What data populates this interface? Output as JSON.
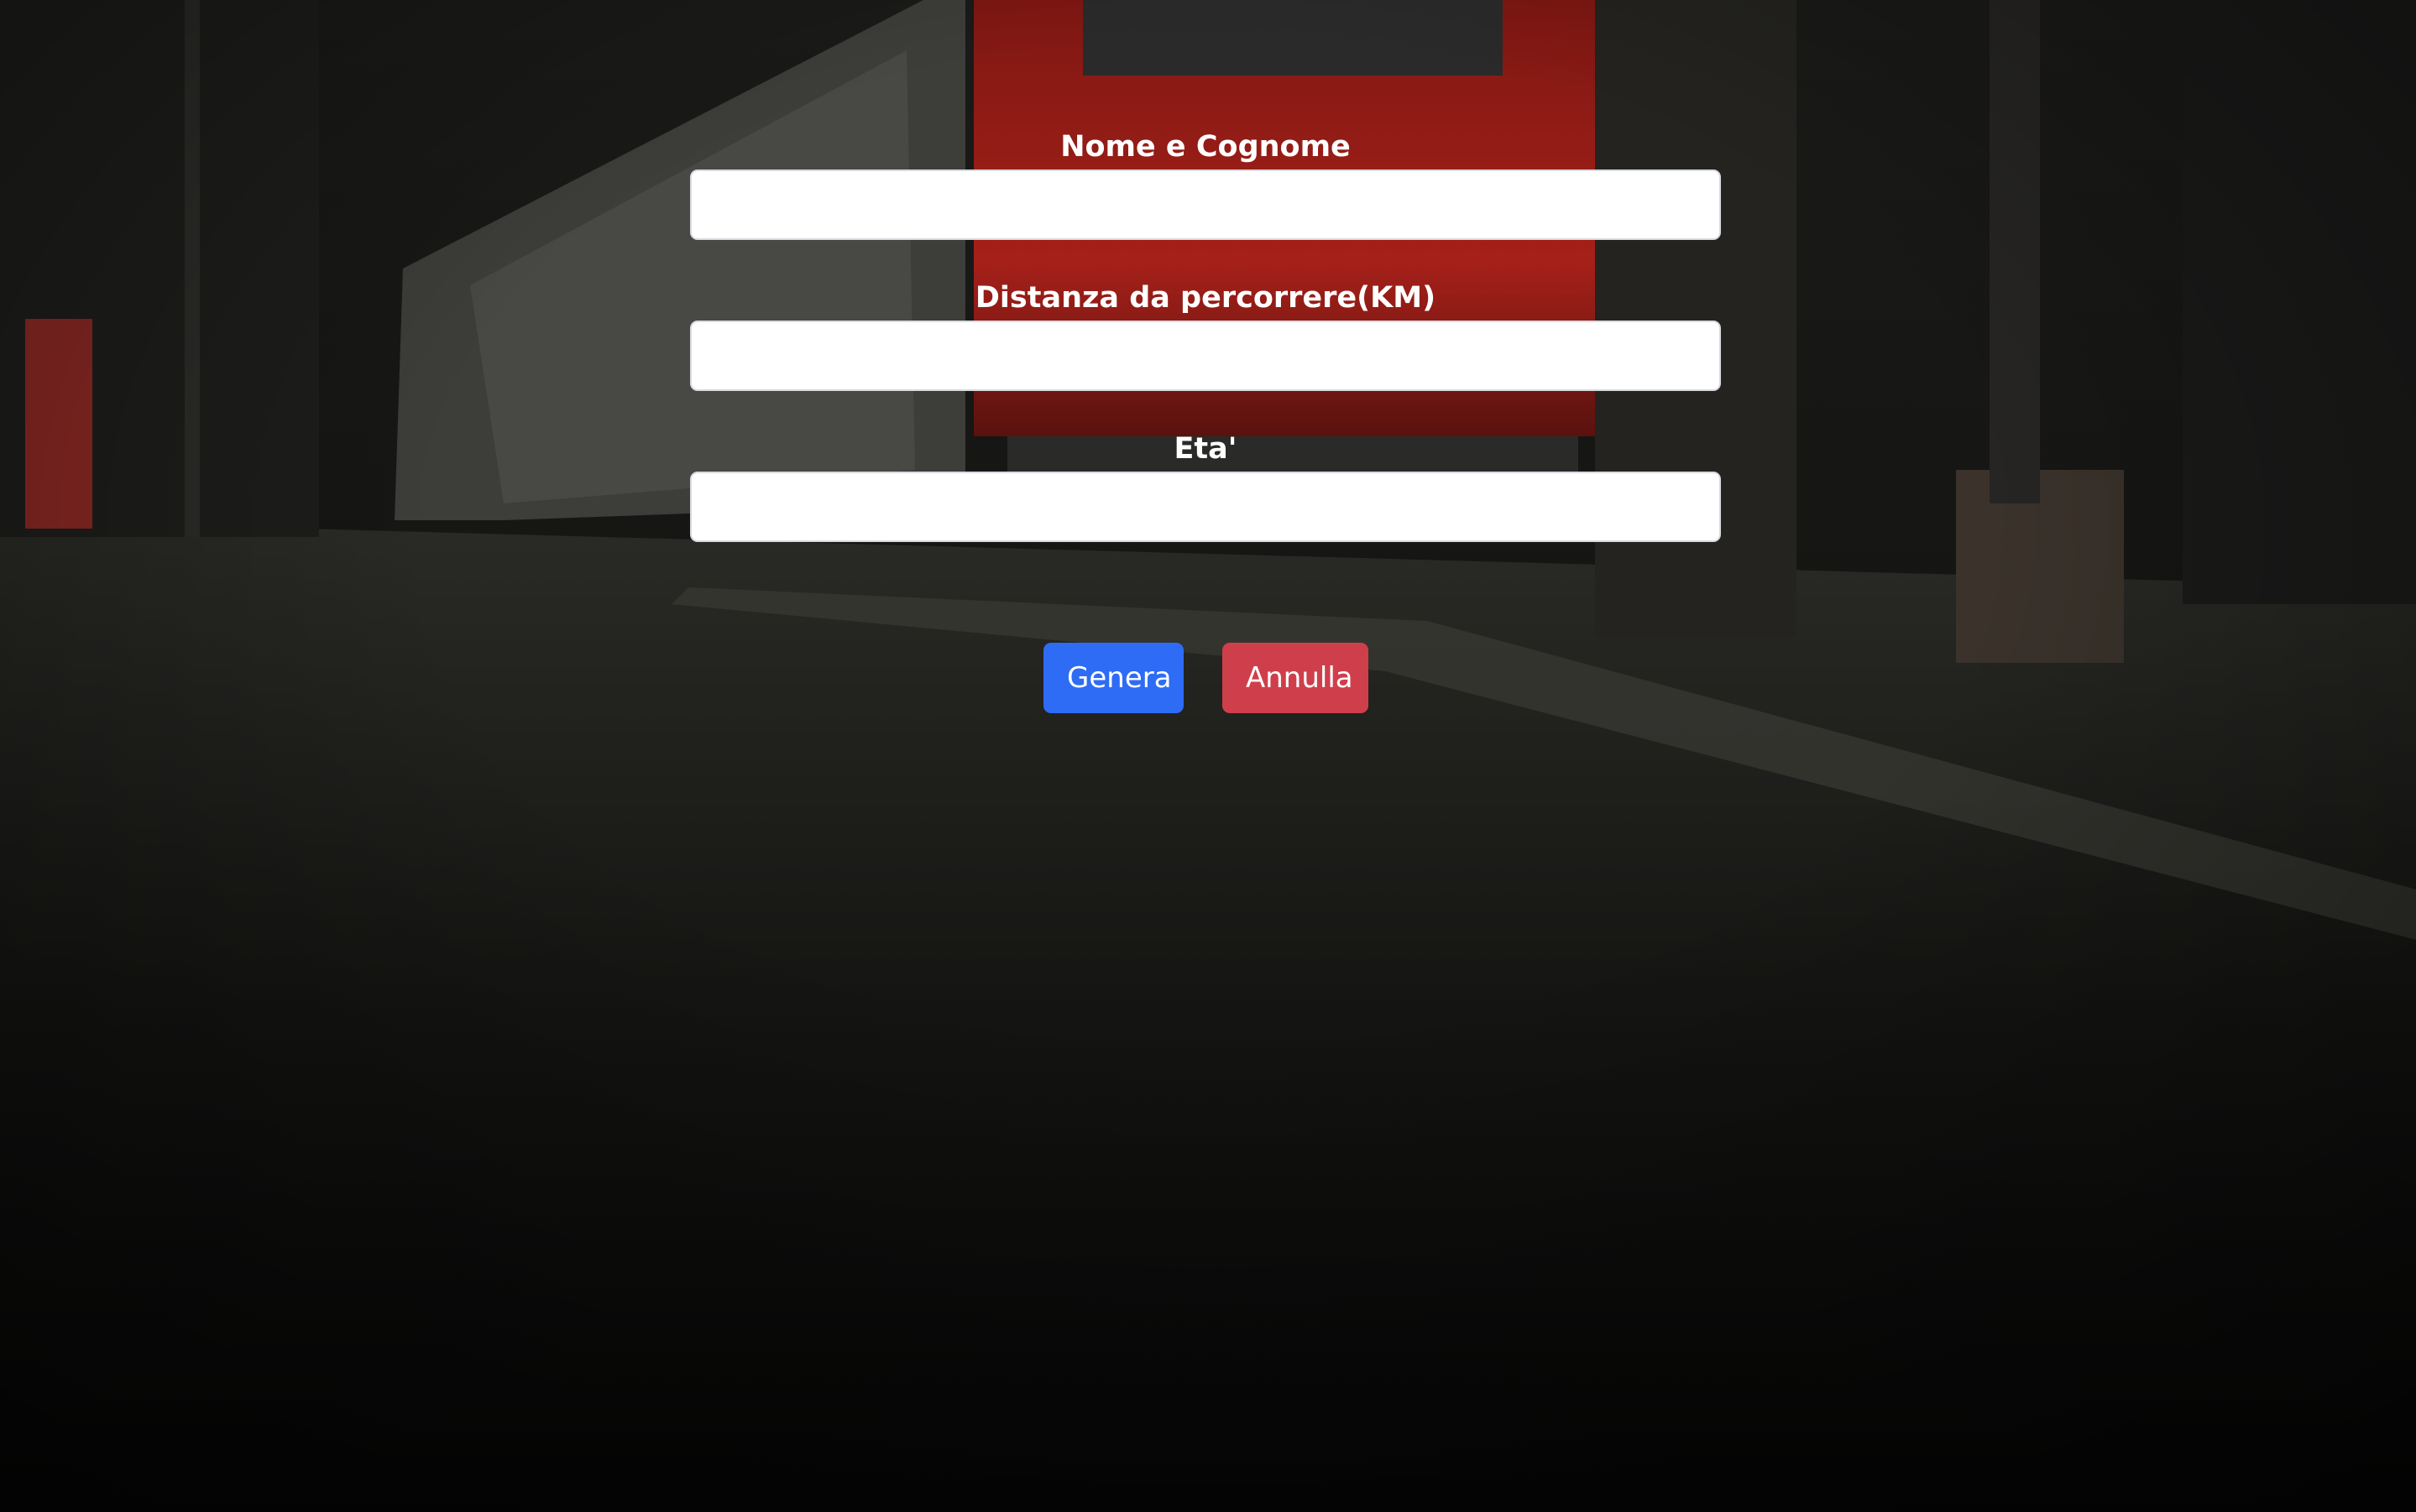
{
  "form": {
    "fields": [
      {
        "label": "Nome e Cognome",
        "value": ""
      },
      {
        "label": "Distanza da percorrere(KM)",
        "value": ""
      },
      {
        "label": "Eta'",
        "value": ""
      }
    ]
  },
  "actions": {
    "generate_label": "Genera",
    "cancel_label": "Annulla"
  },
  "colors": {
    "primary": "#2e6cf6",
    "danger": "#cf3f4b",
    "train_red": "#c62b22"
  }
}
